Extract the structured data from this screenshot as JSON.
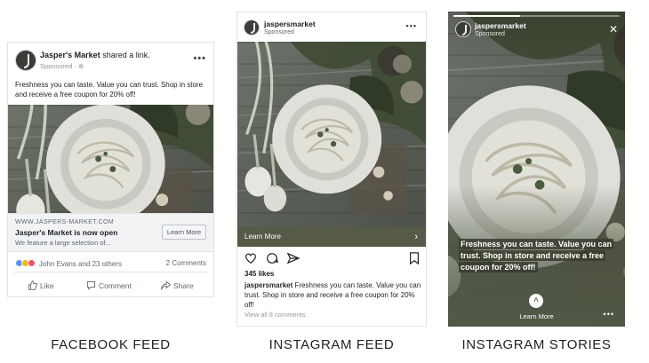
{
  "brand": {
    "name": "Jasper's Market",
    "handle": "jaspersmarket",
    "colors": {
      "fb_text": "#1c1e21",
      "ig_bar": "#565b48",
      "muted": "#606770"
    }
  },
  "facebook": {
    "name": "Jasper's Market",
    "shared": " shared a link.",
    "sponsored": "Sponsored · ⊕",
    "menu": "•••",
    "body": "Freshness you can taste. Value you can trust. Shop in store and receive a free coupon for 20% off!",
    "link": {
      "url": "WWW.JASPERS-MARKET.COM",
      "title": "Jasper's Market is now open",
      "desc": "We feature a large selection of...",
      "button": "Learn More"
    },
    "reactions_text": "John Evans and 23 others",
    "comments": "2 Comments",
    "actions": {
      "like": "Like",
      "comment": "Comment",
      "share": "Share"
    },
    "caption": "FACEBOOK FEED"
  },
  "instagram_feed": {
    "handle": "jaspersmarket",
    "sponsored": "Sponsored",
    "menu": "•••",
    "learn_more": "Learn More",
    "chevron": "›",
    "likes": "345 likes",
    "caption_handle": "jaspersmarket",
    "caption_text": " Freshness you can taste. Value you can trust. Shop in store and receive a free coupon for 20% off!",
    "view_comments": "View all 8 comments",
    "caption": "INSTAGRAM FEED"
  },
  "instagram_stories": {
    "handle": "jaspersmarket",
    "sponsored": "Sponsored",
    "close": "✕",
    "progress": 0.4,
    "overlay_text": "Freshness you can taste. Value you can trust. Shop in store and receive a free coupon for 20% off!",
    "up_arrow": "˄",
    "learn_more": "Learn More",
    "more": "•••",
    "caption": "INSTAGRAM STORIES"
  }
}
